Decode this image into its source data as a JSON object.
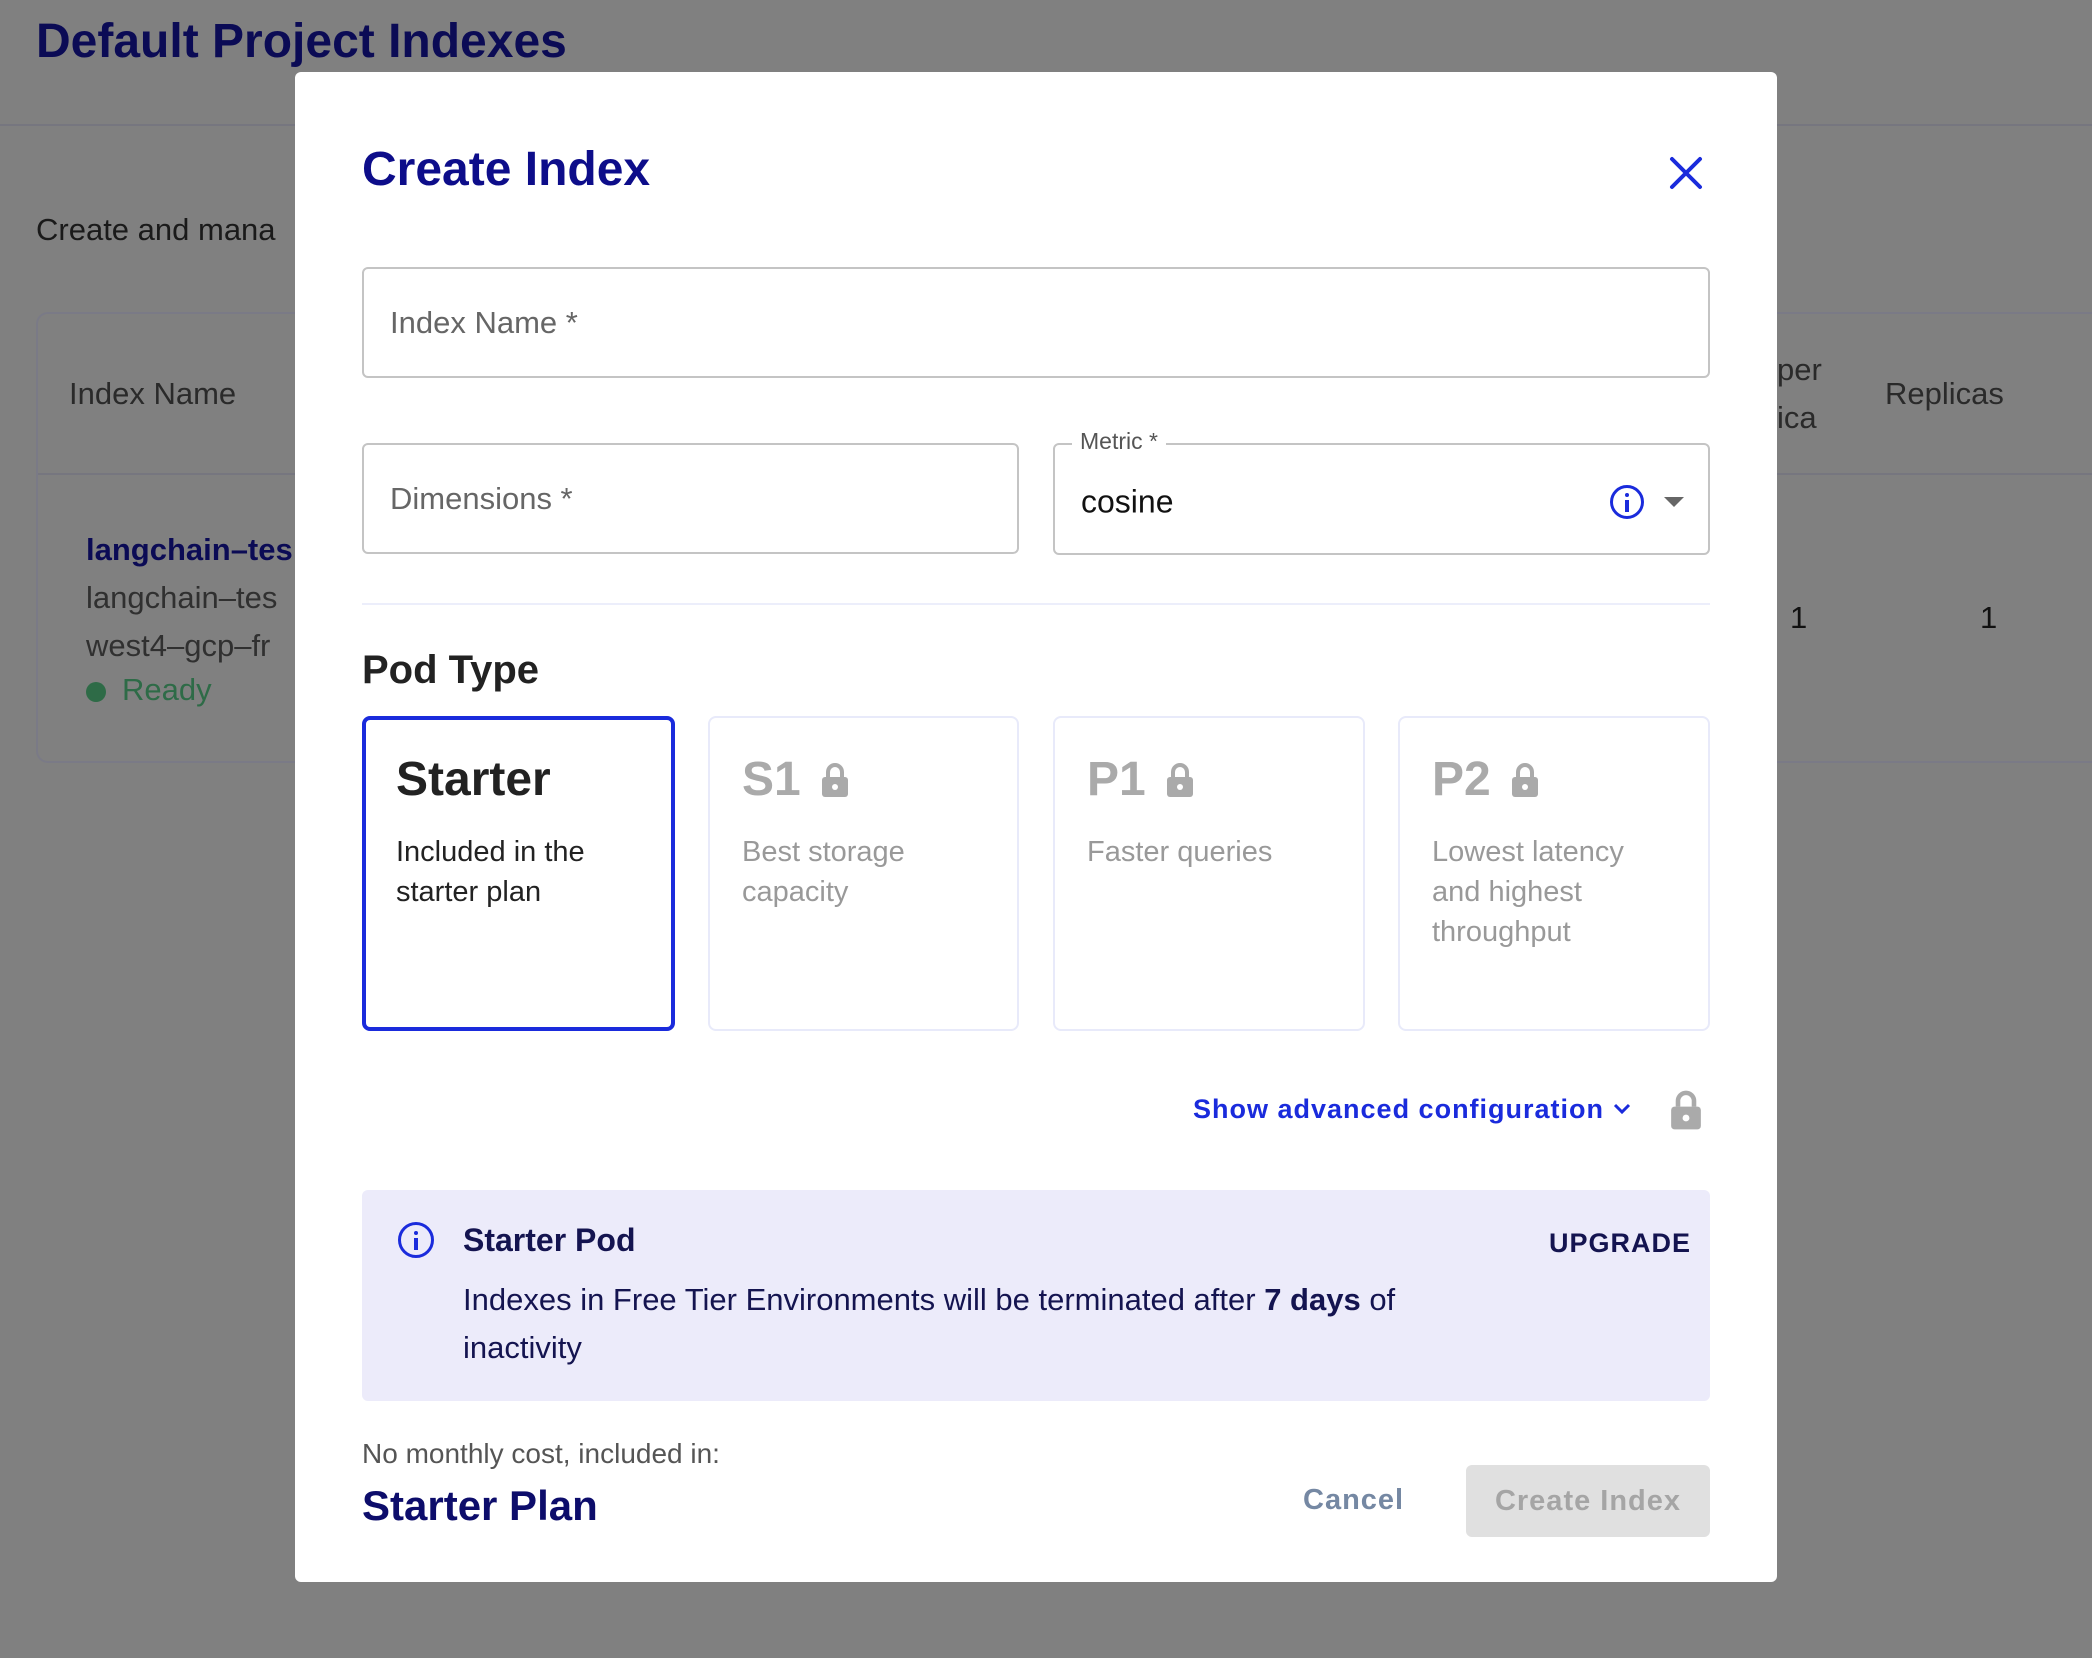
{
  "background": {
    "page_title": "Default Project Indexes",
    "subtitle": "Create and mana",
    "table": {
      "headers": [
        "Index Name",
        "per\nica",
        "Replicas"
      ],
      "header_partial_line1": "per",
      "header_partial_line2": "ica",
      "row": {
        "name": "langchain–tes",
        "line2": "langchain–tes",
        "line3": "west4–gcp–fr",
        "status": "Ready",
        "pods_per_replica": "1",
        "replicas": "1"
      }
    }
  },
  "modal": {
    "title": "Create Index",
    "close_icon": "close-icon",
    "index_name_placeholder": "Index Name *",
    "dimensions_placeholder": "Dimensions *",
    "metric": {
      "label": "Metric *",
      "value": "cosine"
    },
    "pod_type_heading": "Pod Type",
    "pod_types": [
      {
        "name": "Starter",
        "desc": "Included in the starter plan",
        "selected": true,
        "locked": false
      },
      {
        "name": "S1",
        "desc": "Best storage capacity",
        "selected": false,
        "locked": true
      },
      {
        "name": "P1",
        "desc": "Faster queries",
        "selected": false,
        "locked": true
      },
      {
        "name": "P2",
        "desc": "Lowest latency and highest throughput",
        "selected": false,
        "locked": true
      }
    ],
    "advanced_label": "Show advanced configuration",
    "notice": {
      "title": "Starter Pod",
      "action": "UPGRADE",
      "text_before": "Indexes in Free Tier Environments will be terminated after ",
      "text_bold": "7 days",
      "text_after": " of inactivity"
    },
    "cost_label": "No monthly cost, included in:",
    "plan_name": "Starter Plan",
    "cancel_label": "Cancel",
    "create_label": "Create Index"
  },
  "colors": {
    "accent": "#1a2bdc",
    "navy": "#0d0d6b",
    "notice_bg": "#ecebfa",
    "ready": "#2e7d4f"
  }
}
